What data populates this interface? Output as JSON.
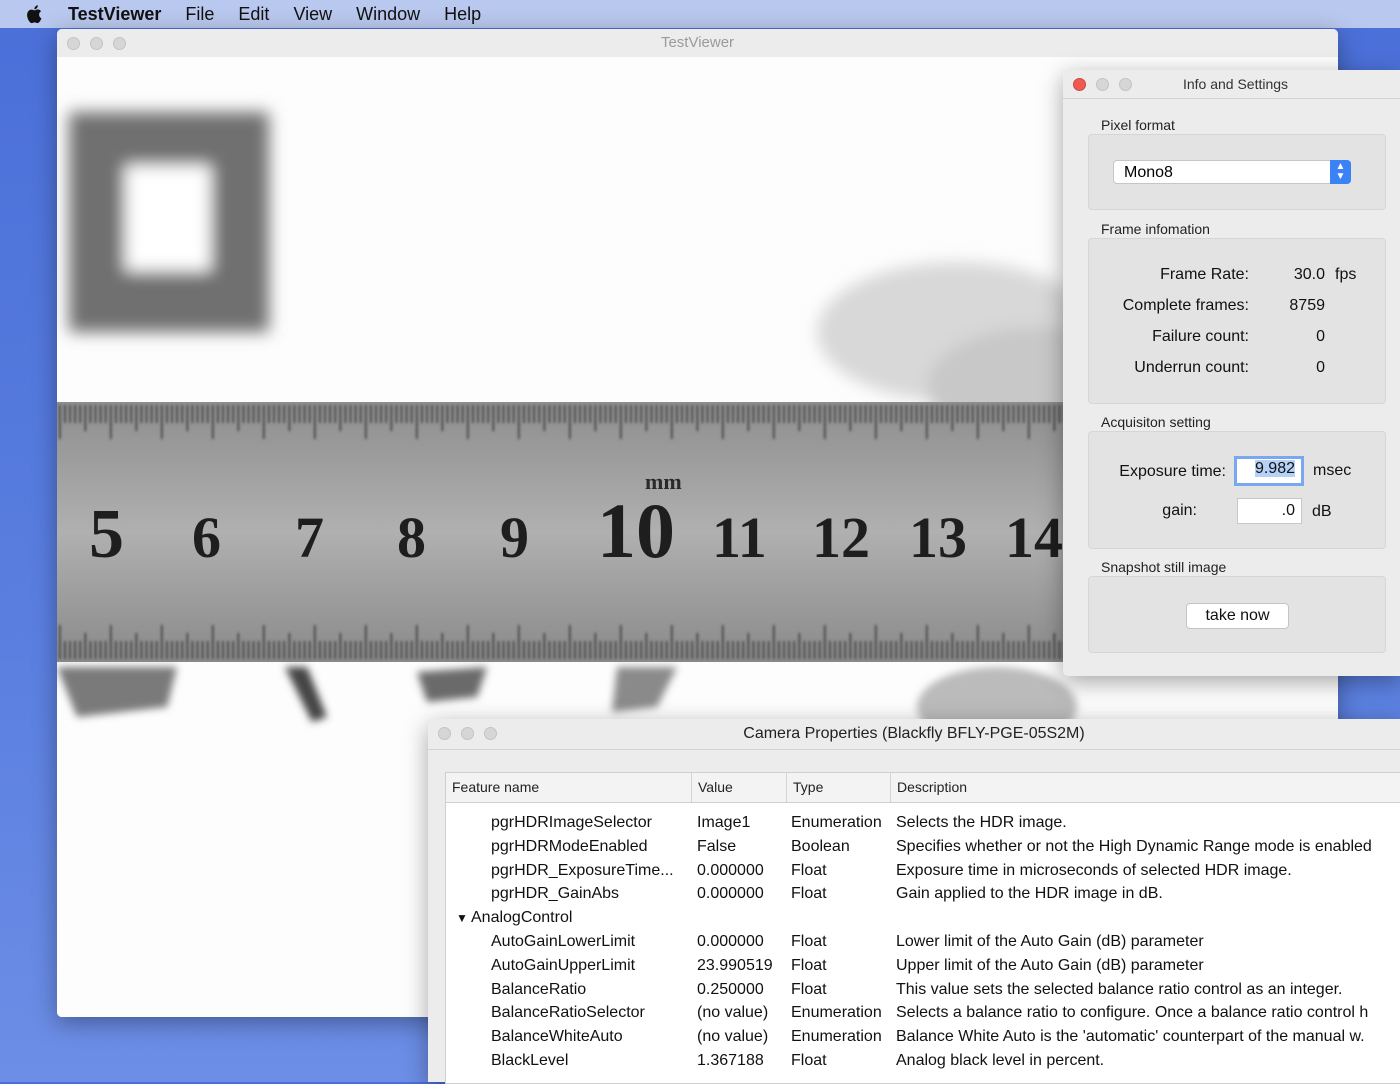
{
  "menubar": {
    "app_name": "TestViewer",
    "items": [
      "File",
      "Edit",
      "View",
      "Window",
      "Help"
    ]
  },
  "viewer": {
    "title": "TestViewer",
    "ruler": {
      "unit_label": "mm",
      "numbers": [
        "5",
        "6",
        "7",
        "8",
        "9",
        "10",
        "11",
        "12",
        "13",
        "14"
      ]
    }
  },
  "info": {
    "title": "Info and Settings",
    "pixel_format": {
      "label": "Pixel format",
      "value": "Mono8"
    },
    "frame": {
      "label": "Frame infomation",
      "frame_rate_label": "Frame Rate:",
      "frame_rate_value": "30.0",
      "frame_rate_unit": "fps",
      "complete_label": "Complete frames:",
      "complete_value": "8759",
      "failure_label": "Failure count:",
      "failure_value": "0",
      "underrun_label": "Underrun count:",
      "underrun_value": "0"
    },
    "acq": {
      "label": "Acquisiton setting",
      "exposure_label": "Exposure time:",
      "exposure_value": "9.982",
      "exposure_unit": "msec",
      "gain_label": "gain:",
      "gain_value": ".0",
      "gain_unit": "dB"
    },
    "snapshot": {
      "label": "Snapshot still image",
      "button": "take now"
    }
  },
  "props": {
    "title": "Camera Properties (Blackfly BFLY-PGE-05S2M)",
    "columns": [
      "Feature name",
      "Value",
      "Type",
      "Description"
    ],
    "group": "AnalogControl",
    "rows_before": [
      {
        "name": "pgrHDRImageSelector",
        "value": "Image1",
        "type": "Enumeration",
        "desc": "Selects the HDR image."
      },
      {
        "name": "pgrHDRModeEnabled",
        "value": "False",
        "type": "Boolean",
        "desc": "Specifies whether or not the High Dynamic Range mode is enabled"
      },
      {
        "name": "pgrHDR_ExposureTime...",
        "value": "0.000000",
        "type": "Float",
        "desc": "Exposure time in microseconds of selected HDR image."
      },
      {
        "name": "pgrHDR_GainAbs",
        "value": "0.000000",
        "type": "Float",
        "desc": "Gain applied to the HDR image in dB."
      }
    ],
    "rows_after": [
      {
        "name": "AutoGainLowerLimit",
        "value": "0.000000",
        "type": "Float",
        "desc": "Lower limit of the Auto Gain (dB) parameter"
      },
      {
        "name": "AutoGainUpperLimit",
        "value": "23.990519",
        "type": "Float",
        "desc": "Upper limit of the Auto Gain (dB) parameter"
      },
      {
        "name": "BalanceRatio",
        "value": "0.250000",
        "type": "Float",
        "desc": "This value sets the selected balance ratio control as an integer."
      },
      {
        "name": "BalanceRatioSelector",
        "value": "(no value)",
        "type": "Enumeration",
        "desc": "Selects a balance ratio to configure. Once a balance ratio control h"
      },
      {
        "name": "BalanceWhiteAuto",
        "value": "(no value)",
        "type": "Enumeration",
        "desc": "Balance White Auto is the 'automatic' counterpart of the manual w."
      },
      {
        "name": "BlackLevel",
        "value": "1.367188",
        "type": "Float",
        "desc": "Analog black level in percent."
      }
    ]
  }
}
